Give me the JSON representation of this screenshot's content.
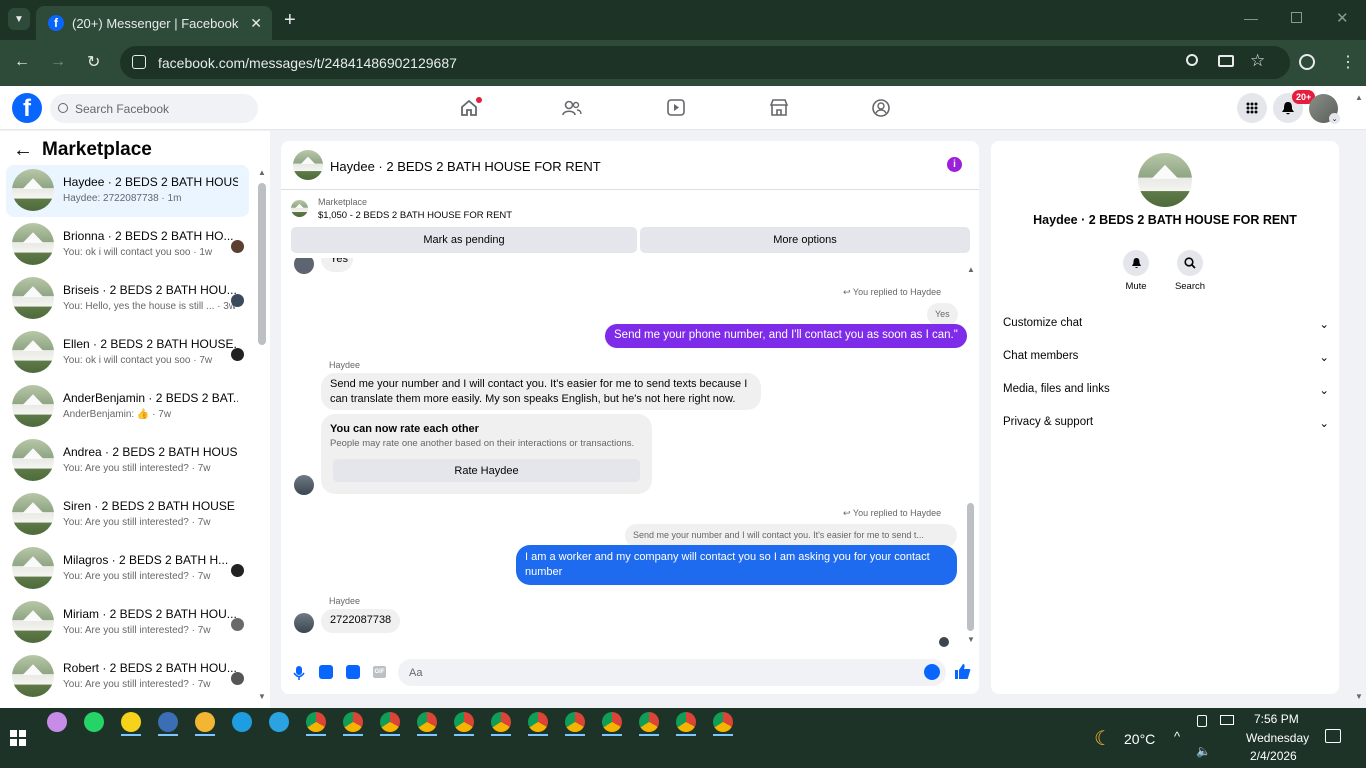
{
  "browser": {
    "tab_title": "(20+) Messenger | Facebook",
    "url": "facebook.com/messages/t/24841486902129687"
  },
  "fb": {
    "search_placeholder": "Search Facebook",
    "notif_badge": "20+"
  },
  "left": {
    "heading": "Marketplace",
    "items": [
      {
        "title": "Haydee · 2 BEDS 2 BATH HOUS...",
        "sub": "Haydee: 2722087738 · 1m"
      },
      {
        "title": "Brionna · 2 BEDS 2 BATH HO...",
        "sub": "You: ok i will contact you soo · 1w"
      },
      {
        "title": "Briseis · 2 BEDS 2 BATH HOU...",
        "sub": "You: Hello, yes the house is still ... · 3w"
      },
      {
        "title": "Ellen · 2 BEDS 2 BATH HOUSE...",
        "sub": "You: ok i will contact you soo · 7w"
      },
      {
        "title": "AnderBenjamin · 2 BEDS 2 BAT...",
        "sub": "AnderBenjamin: 👍 · 7w"
      },
      {
        "title": "Andrea · 2 BEDS 2 BATH HOUS...",
        "sub": "You: Are you still interested? · 7w"
      },
      {
        "title": "Siren · 2 BEDS 2 BATH HOUSE F...",
        "sub": "You: Are you still interested? · 7w"
      },
      {
        "title": "Milagros · 2 BEDS 2 BATH H...",
        "sub": "You: Are you still interested? · 7w"
      },
      {
        "title": "Miriam · 2 BEDS 2 BATH HOU...",
        "sub": "You: Are you still interested? · 7w"
      },
      {
        "title": "Robert · 2 BEDS 2 BATH HOU...",
        "sub": "You: Are you still interested? · 7w"
      }
    ]
  },
  "chat": {
    "title": "Haydee · 2 BEDS 2 BATH HOUSE FOR RENT",
    "listing_label": "Marketplace",
    "listing_price": "$1,050 - 2 BEDS 2 BATH HOUSE FOR RENT",
    "mark_pending": "Mark as pending",
    "more_options": "More options",
    "cut_text": "Yes",
    "replied1": "You replied to Haydee",
    "quoted1": "Yes",
    "msg_out1": "Send me your phone number, and I'll contact you as soon as I can.\"",
    "sender1": "Haydee",
    "msg_in1": "Send me your number and I will contact you. It's easier for me to send texts because I can translate them more easily. My son speaks English, but he's not here right now.",
    "rate_title": "You can now rate each other",
    "rate_sub": "People may rate one another based on their interactions or transactions.",
    "rate_button": "Rate Haydee",
    "replied2": "You replied to Haydee",
    "quoted2": "Send me your number and I will contact you. It's easier for me to send t...",
    "msg_out2": "I am a worker and my company will contact you so I am asking you for your contact number",
    "sender2": "Haydee",
    "msg_in2": "2722087738",
    "composer_placeholder": "Aa"
  },
  "right": {
    "title": "Haydee · 2 BEDS 2 BATH HOUSE FOR RENT",
    "mute": "Mute",
    "search": "Search",
    "menu": [
      "Customize chat",
      "Chat members",
      "Media, files and links",
      "Privacy & support"
    ]
  },
  "taskbar": {
    "weather": "20°C",
    "time": "7:56 PM",
    "day": "Wednesday",
    "date": "2/4/2026"
  },
  "colors": {
    "fb_blue": "#0866ff",
    "messenger_purple": "#7e2bea",
    "chrome_green": "#2e4a39"
  }
}
